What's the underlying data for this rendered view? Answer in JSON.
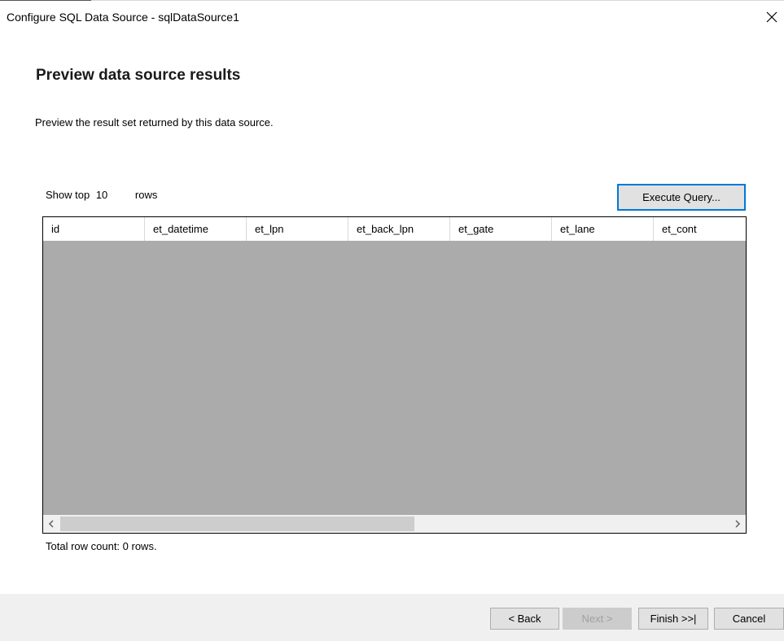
{
  "window": {
    "title": "Configure SQL Data Source - sqlDataSource1"
  },
  "page": {
    "heading": "Preview data source results",
    "description": "Preview the result set returned by this data source."
  },
  "preview": {
    "show_top_label": "Show top",
    "show_top_count": "10",
    "rows_label": "rows",
    "execute_button": "Execute Query...",
    "columns": [
      "id",
      "et_datetime",
      "et_lpn",
      "et_back_lpn",
      "et_gate",
      "et_lane",
      "et_cont"
    ],
    "total_row_count": "Total row count: 0 rows."
  },
  "footer": {
    "back": "< Back",
    "next": "Next >",
    "finish": "Finish >>|",
    "cancel": "Cancel"
  },
  "icons": {
    "close": "close-icon",
    "scroll_left": "chevron-left-icon",
    "scroll_right": "chevron-right-icon"
  },
  "colors": {
    "grid_background": "#ababab",
    "accent_border": "#0078d7",
    "footer_background": "#f0f0f0"
  }
}
